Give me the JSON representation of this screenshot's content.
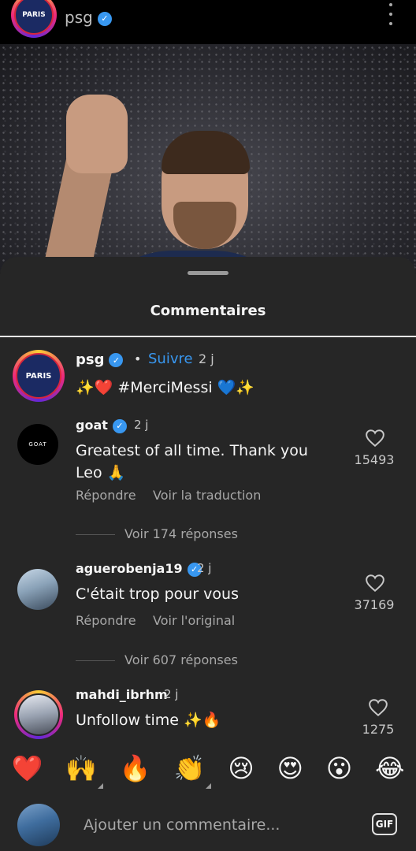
{
  "post": {
    "username": "psg",
    "logo_text": "PARIS"
  },
  "sheet": {
    "title": "Commentaires"
  },
  "caption": {
    "username": "psg",
    "dot": "•",
    "follow_label": "Suivre",
    "time": "2 j",
    "text": "✨❤️ #MerciMessi 💙✨"
  },
  "comments": [
    {
      "username": "goat",
      "avatar_text": "GOAT",
      "time": "2 j",
      "text": "Greatest of all time. Thank you Leo 🙏",
      "likes": "15493",
      "reply_label": "Répondre",
      "translate_label": "Voir la traduction",
      "replies_label": "Voir 174 réponses"
    },
    {
      "username": "aguerobenja19",
      "time": "2 j",
      "text": "C'était trop pour vous",
      "likes": "37169",
      "reply_label": "Répondre",
      "translate_label": "Voir l'original",
      "replies_label": "Voir 607 réponses"
    },
    {
      "username": "mahdi_ibrhm",
      "time": "2 j",
      "text": "Unfollow time ✨🔥",
      "likes": "1275"
    }
  ],
  "emojis": [
    "❤️",
    "🙌",
    "🔥",
    "👏",
    "😢",
    "😍",
    "😮",
    "😂"
  ],
  "compose": {
    "placeholder": "Ajouter un commentaire...",
    "gif_label": "GIF"
  },
  "colors": {
    "accent": "#3897f0",
    "sheet_bg": "#262626"
  }
}
